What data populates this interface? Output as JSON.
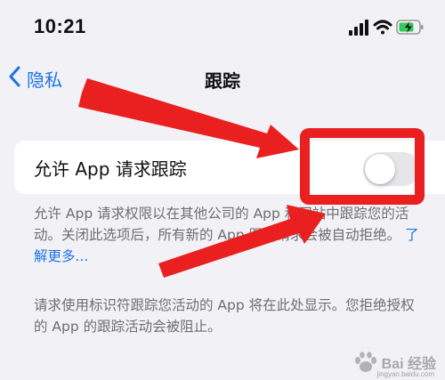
{
  "status_bar": {
    "time": "10:21",
    "icons": [
      "cellular-signal-icon",
      "wifi-icon",
      "battery-charging-icon"
    ]
  },
  "nav": {
    "back_label": "隐私",
    "title": "跟踪"
  },
  "tracking_setting": {
    "label": "允许 App 请求跟踪",
    "enabled": false
  },
  "footer": {
    "description": "允许 App 请求权限以在其他公司的 App 和网站中跟踪您的活动。关闭此选项后，所有新的 App 跟踪请求会被自动拒绝。",
    "learn_more": "了解更多...",
    "info": "请求使用标识符跟踪您活动的 App 将在此处显示。您拒绝授权的 App 的跟踪活动会被阻止。"
  },
  "annotations": {
    "color": "#ea1f1f"
  },
  "watermark": {
    "text": "Bai 经验",
    "domain": "jingyan.baidu.com"
  },
  "colors": {
    "background": "#f2f2f6",
    "accent": "#1a73e8",
    "toggle_off": "#e5e5ea",
    "secondary_text": "#6e6e73"
  }
}
